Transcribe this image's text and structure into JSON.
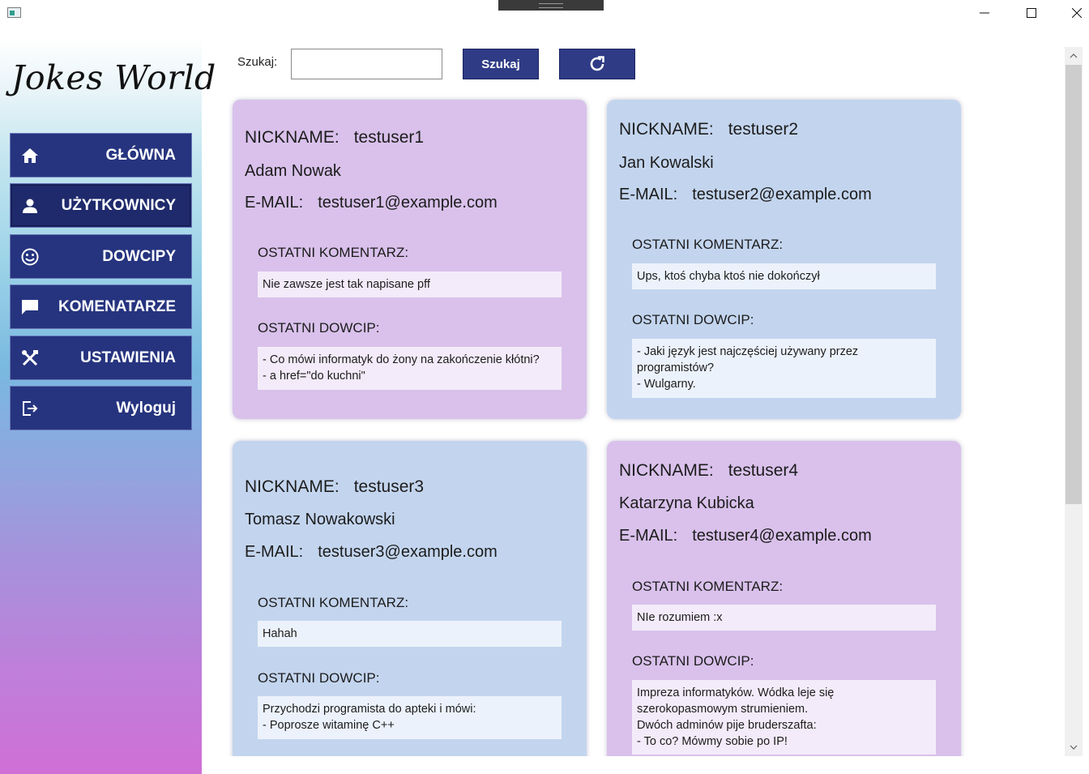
{
  "window": {
    "minimize_icon": "minimize-icon",
    "maximize_icon": "maximize-icon",
    "close_icon": "close-icon"
  },
  "sidebar": {
    "title": "Jokes World",
    "items": [
      {
        "label": "GŁÓWNA",
        "icon": "home-icon"
      },
      {
        "label": "UŻYTKOWNICY",
        "icon": "user-icon",
        "active": true
      },
      {
        "label": "DOWCIPY",
        "icon": "smiley-icon"
      },
      {
        "label": "KOMENATARZE",
        "icon": "comment-icon"
      },
      {
        "label": "USTAWIENIA",
        "icon": "tools-icon"
      },
      {
        "label": "Wyloguj",
        "icon": "logout-icon"
      }
    ]
  },
  "search": {
    "label": "Szukaj:",
    "value": "",
    "button_label": "Szukaj",
    "refresh_icon": "refresh-icon"
  },
  "users": [
    {
      "nickname_label": "NICKNAME:",
      "nickname": "testuser1",
      "full_name": "Adam Nowak",
      "email_label": "E-MAIL:",
      "email": "testuser1@example.com",
      "comment_label": "OSTATNI KOMENTARZ:",
      "comment": "Nie zawsze jest tak napisane pff",
      "joke_label": "OSTATNI DOWCIP:",
      "joke": "- Co mówi informatyk do żony na zakończenie kłótni?\n- a href=\"do kuchni\"",
      "color": "#d9c1eb"
    },
    {
      "nickname_label": "NICKNAME:",
      "nickname": "testuser2",
      "full_name": "Jan Kowalski",
      "email_label": "E-MAIL:",
      "email": "testuser2@example.com",
      "comment_label": "OSTATNI KOMENTARZ:",
      "comment": "Ups, ktoś chyba ktoś nie dokończył",
      "joke_label": "OSTATNI DOWCIP:",
      "joke": "- Jaki język jest najczęściej używany przez programistów?\n- Wulgarny.",
      "color": "#c3d5ee"
    },
    {
      "nickname_label": "NICKNAME:",
      "nickname": "testuser3",
      "full_name": "Tomasz Nowakowski",
      "email_label": "E-MAIL:",
      "email": "testuser3@example.com",
      "comment_label": "OSTATNI KOMENTARZ:",
      "comment": "Hahah",
      "joke_label": "OSTATNI DOWCIP:",
      "joke": "Przychodzi programista do apteki i mówi:\n- Poprosze witaminę C++",
      "color": "#c3d5ee"
    },
    {
      "nickname_label": "NICKNAME:",
      "nickname": "testuser4",
      "full_name": "Katarzyna Kubicka",
      "email_label": "E-MAIL:",
      "email": "testuser4@example.com",
      "comment_label": "OSTATNI KOMENTARZ:",
      "comment": "NIe rozumiem :x",
      "joke_label": "OSTATNI DOWCIP:",
      "joke": "Impreza informatyków. Wódka leje się szerokopasmowym strumieniem.\nDwóch adminów pije bruderszafta:\n- To co? Mówmy sobie po IP!",
      "color": "#d9c1eb"
    }
  ]
}
